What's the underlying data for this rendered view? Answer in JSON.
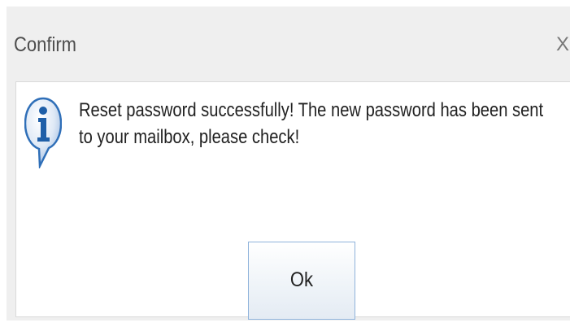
{
  "dialog": {
    "title": "Confirm",
    "close_label": "X",
    "icon": "info-icon",
    "message_lines": [
      "Reset password successfully! The new password has been sent",
      "to your mailbox, please check!"
    ],
    "ok_label": "Ok"
  },
  "colors": {
    "title_bar_bg": "#efefef",
    "content_bg": "#ffffff",
    "icon_blue": "#2f6fb8",
    "button_border": "#8fb3db"
  }
}
